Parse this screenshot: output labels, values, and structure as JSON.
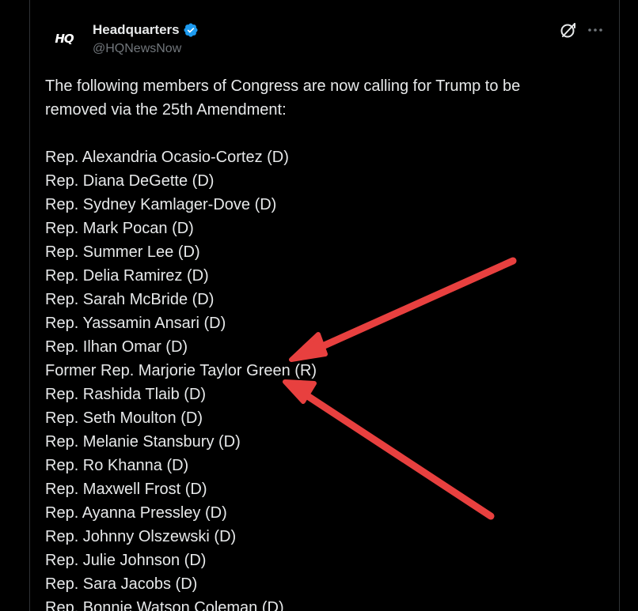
{
  "account": {
    "display_name": "Headquarters",
    "handle": "@HQNewsNow",
    "avatar_text": "HQ",
    "verified_color": "#1d9bf0"
  },
  "tweet": {
    "intro": [
      "The following members of Congress are now calling for Trump to be",
      "removed via the 25th Amendment:"
    ],
    "members": [
      "Rep. Alexandria Ocasio-Cortez (D)",
      "Rep. Diana DeGette (D)",
      "Rep. Sydney Kamlager-Dove (D)",
      "Rep. Mark Pocan (D)",
      "Rep. Summer Lee (D)",
      "Rep. Delia Ramirez (D)",
      "Rep. Sarah McBride (D)",
      "Rep. Yassamin Ansari (D)",
      "Rep. Ilhan Omar (D)",
      "Former Rep. Marjorie Taylor Green (R)",
      "Rep. Rashida Tlaib (D)",
      "Rep. Seth Moulton (D)",
      "Rep. Melanie Stansbury (D)",
      "Rep. Ro Khanna (D)",
      "Rep. Maxwell Frost (D)",
      "Rep. Ayanna Pressley (D)",
      "Rep. Johnny Olszewski (D)",
      "Rep. Julie Johnson (D)",
      "Rep. Sara Jacobs (D)",
      "Rep. Bonnie Watson Coleman (D)"
    ]
  },
  "icons": {
    "grok": "grok-icon",
    "more": "more-icon",
    "verified": "verified-badge-icon"
  },
  "annotation": {
    "arrow_color": "#e8403f",
    "arrow_count": 2
  }
}
